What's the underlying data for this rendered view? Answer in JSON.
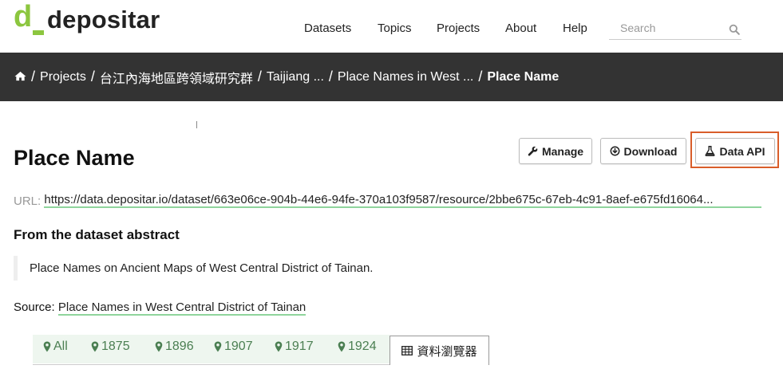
{
  "brand": {
    "name": "depositar",
    "mark": "d",
    "accent_color": "#8cc63f"
  },
  "nav": {
    "items": [
      {
        "label": "Datasets"
      },
      {
        "label": "Topics"
      },
      {
        "label": "Projects"
      },
      {
        "label": "About"
      },
      {
        "label": "Help"
      }
    ],
    "search_placeholder": "Search"
  },
  "breadcrumb": {
    "home_icon": "home-icon",
    "items": [
      {
        "label": "Projects"
      },
      {
        "label": "台江內海地區跨領域研究群"
      },
      {
        "label": "Taijiang ..."
      },
      {
        "label": "Place Names in West ..."
      },
      {
        "label": "Place Name"
      }
    ]
  },
  "resource": {
    "title": "Place Name",
    "url_label": "URL:",
    "url": "https://data.depositar.io/dataset/663e06ce-904b-44e6-94fe-370a103f9587/resource/2bbe675c-67eb-4c91-8aef-e675fd16064...",
    "abstract_heading": "From the dataset abstract",
    "abstract": "Place Names on Ancient Maps of West Central District of Tainan.",
    "source_label": "Source:",
    "source_link": "Place Names in West Central District of Tainan"
  },
  "actions": {
    "manage": "Manage",
    "download": "Download",
    "data_api": "Data API",
    "highlight_color": "#d95d2a"
  },
  "views": {
    "tabs": [
      {
        "label": "All"
      },
      {
        "label": "1875"
      },
      {
        "label": "1896"
      },
      {
        "label": "1907"
      },
      {
        "label": "1917"
      },
      {
        "label": "1924"
      }
    ],
    "active_tab": "資料瀏覽器"
  }
}
